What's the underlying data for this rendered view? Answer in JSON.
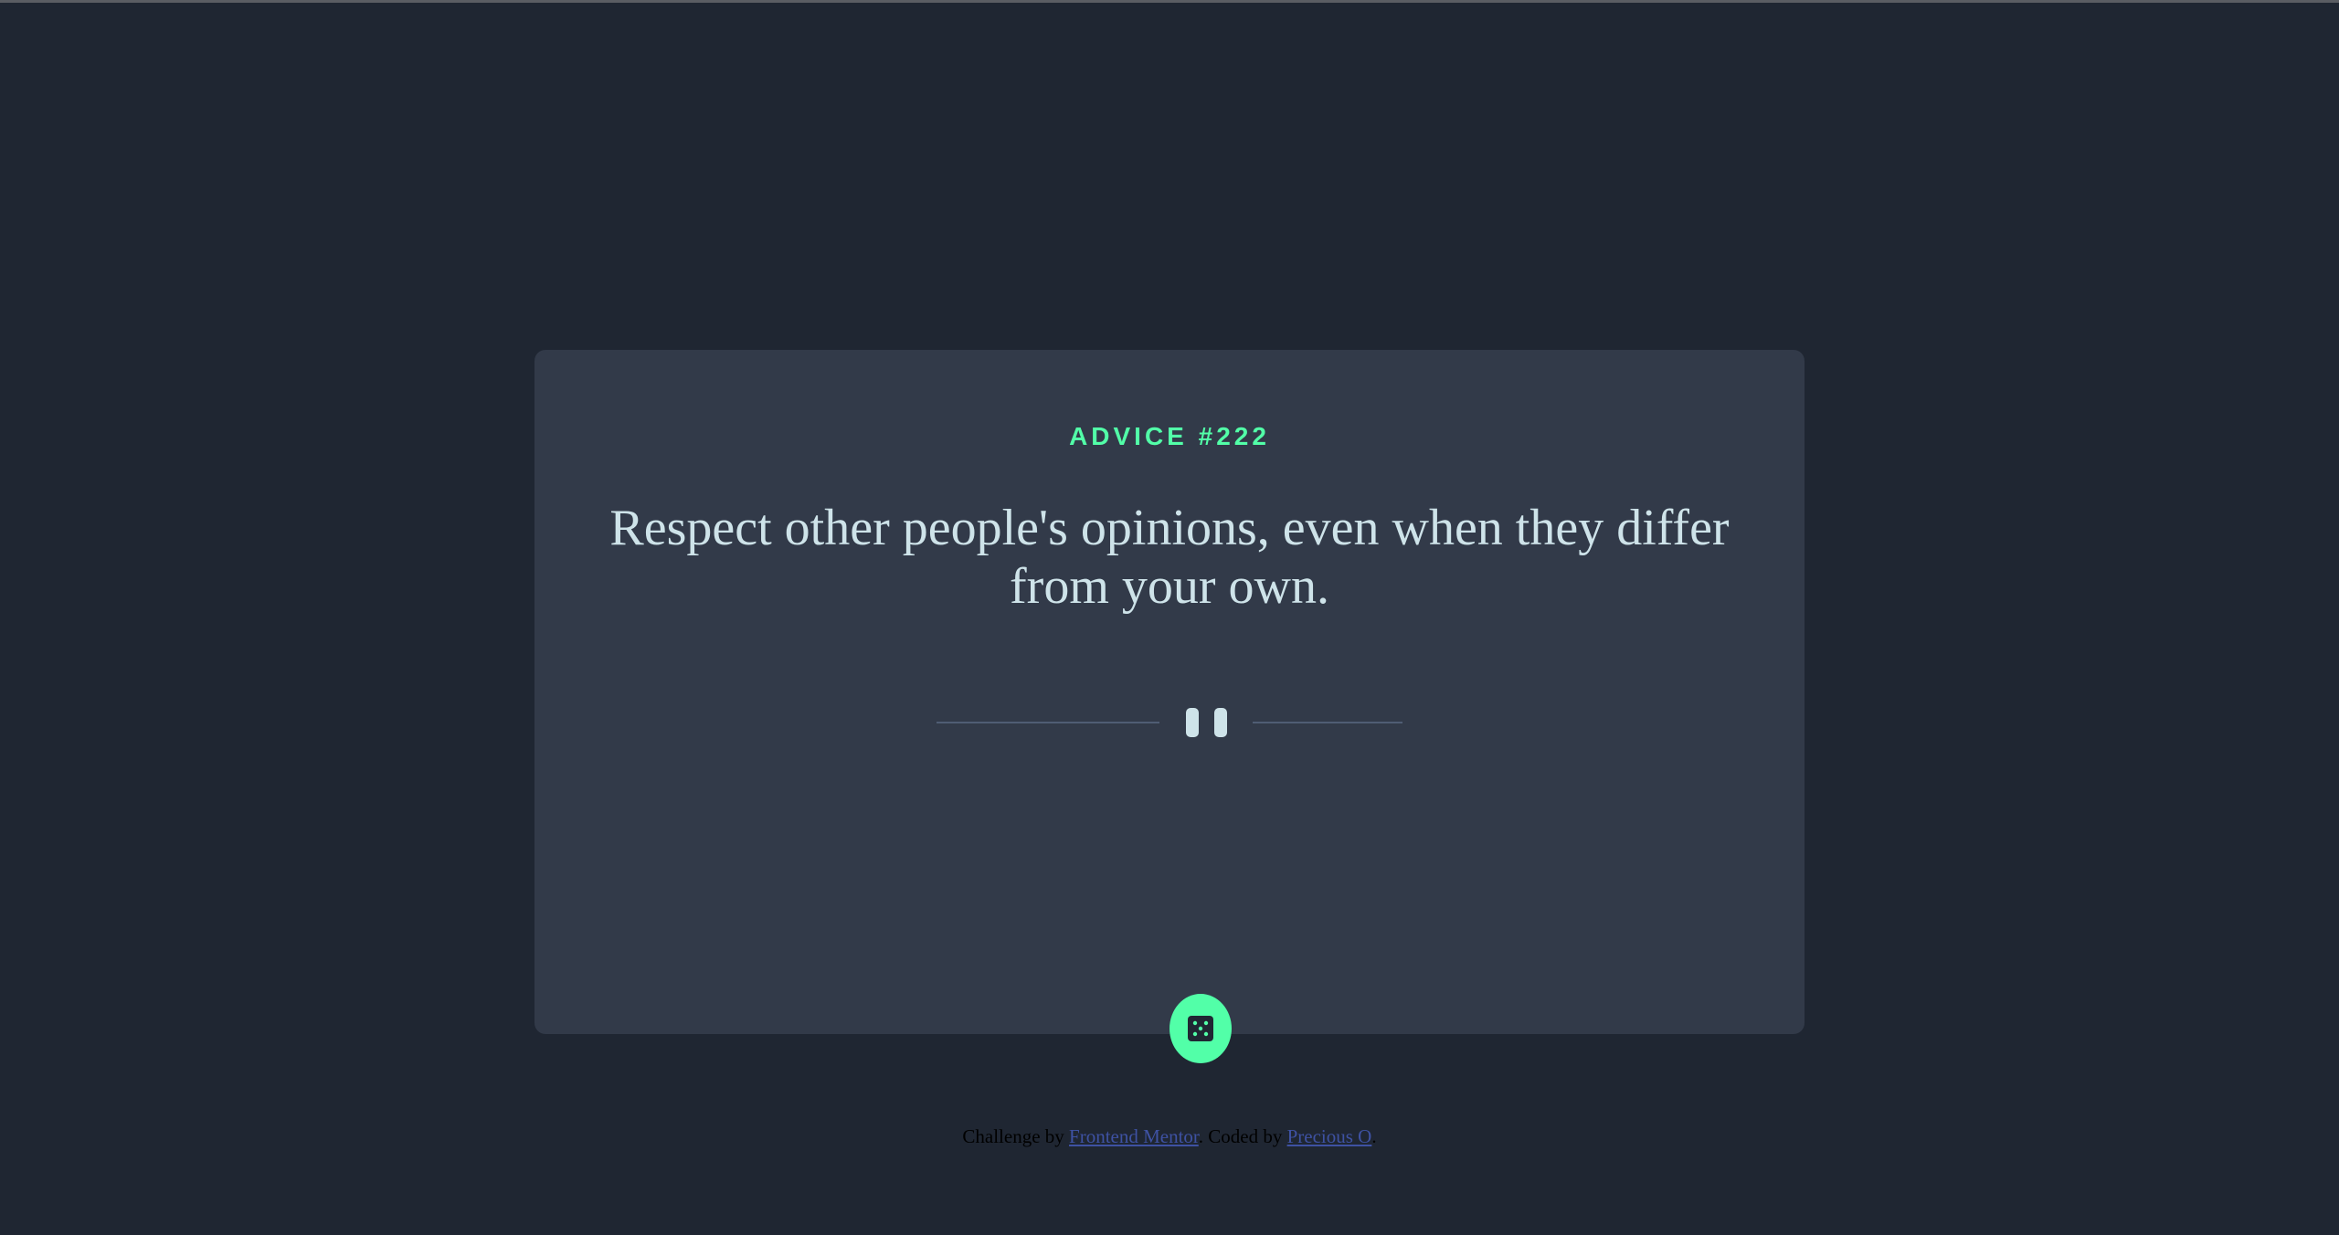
{
  "advice": {
    "label": "ADVICE #222",
    "quote": "Respect other people's opinions, even when they differ from your own."
  },
  "footer": {
    "challenge_prefix": "Challenge by",
    "challenge_link": "Frontend Mentor",
    "coded_prefix": ". Coded by",
    "coded_link": "Precious O",
    "suffix": "."
  },
  "icons": {
    "divider": "pause-icon",
    "button": "dice-icon"
  },
  "colors": {
    "background": "#1f2632",
    "card": "#323a49",
    "accent": "#52ffa8",
    "text": "#cee3e9",
    "link": "#3e52a3"
  }
}
